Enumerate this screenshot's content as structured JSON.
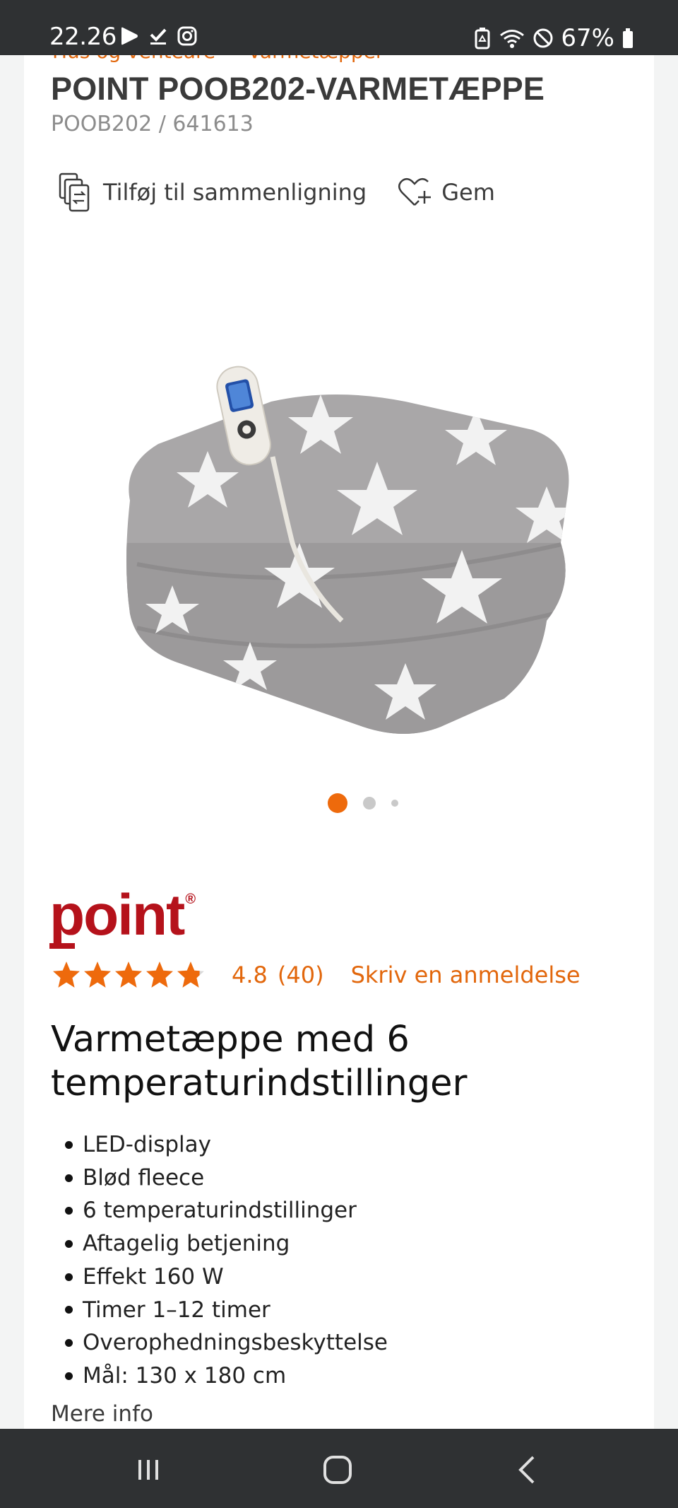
{
  "status_bar": {
    "time": "22.26",
    "battery": "67%"
  },
  "breadcrumb": {
    "text": "Hus og venteare — Varmetæpper"
  },
  "product": {
    "title": "POINT POOB202-VARMETÆPPE",
    "sku": "POOB202 / 641613",
    "compare_label": "Tilføj til sammenligning",
    "save_label": "Gem"
  },
  "gallery": {
    "image_count": 3,
    "active_index": 0
  },
  "brand": {
    "name": "point",
    "reg_mark": "®"
  },
  "rating": {
    "score": "4.8",
    "count": "(40)",
    "stars": 4.8,
    "write_review": "Skriv en anmeldelse"
  },
  "description": {
    "headline": "Varmetæppe med 6 temperaturindstillinger",
    "features": [
      "LED-display",
      "Blød fleece",
      "6 temperaturindstillinger",
      "Aftagelig betjening",
      "Effekt 160 W",
      "Timer 1–12 timer",
      "Overophedningsbeskyttelse",
      "Mål: 130 x 180 cm"
    ],
    "more_info": "Mere info"
  },
  "colors": {
    "accent": "#ee6a0c",
    "brand_red": "#b5121b",
    "bars": "#2f3133"
  }
}
